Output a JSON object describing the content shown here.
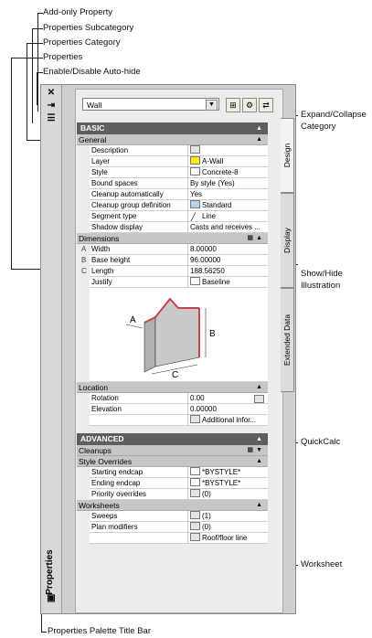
{
  "callouts": {
    "add_only": "Add-only Property",
    "subcategory": "Properties Subcategory",
    "category": "Properties Category",
    "properties": "Properties",
    "auto_hide": "Enable/Disable Auto-hide",
    "expand_collapse_1": "Expand/Collapse",
    "expand_collapse_2": "Category",
    "show_hide_1": "Show/Hide",
    "show_hide_2": "Illustration",
    "quickcalc": "QuickCalc",
    "worksheet": "Worksheet",
    "title_bar": "Properties Palette Title Bar"
  },
  "palette": {
    "title": "Properties",
    "close_glyph": "✕",
    "autohide_glyph": "⇥",
    "props_glyph": "☰",
    "tabs": [
      "Design",
      "Display",
      "Extended Data"
    ],
    "combo_value": "Wall"
  },
  "basic": {
    "header": "BASIC",
    "general": "General",
    "rows": [
      {
        "k": "Description",
        "v": ""
      },
      {
        "k": "Layer",
        "v": "A-Wall"
      },
      {
        "k": "Style",
        "v": "Concrete-8"
      },
      {
        "k": "Bound spaces",
        "v": "By style (Yes)"
      },
      {
        "k": "Cleanup automatically",
        "v": "Yes"
      },
      {
        "k": "Cleanup group definition",
        "v": "Standard"
      },
      {
        "k": "Segment type",
        "v": "Line"
      },
      {
        "k": "Shadow display",
        "v": "Casts and receives ..."
      }
    ],
    "dimensions": "Dimensions",
    "dim_rows": [
      {
        "letter": "A",
        "k": "Width",
        "v": "8.00000"
      },
      {
        "letter": "B",
        "k": "Base height",
        "v": "96.00000"
      },
      {
        "letter": "C",
        "k": "Length",
        "v": "188.56250"
      },
      {
        "letter": "",
        "k": "Justify",
        "v": "Baseline"
      }
    ],
    "illus_labels": {
      "a": "A",
      "b": "B",
      "c": "C"
    },
    "location": "Location",
    "loc_rows": [
      {
        "k": "Rotation",
        "v": "0.00"
      },
      {
        "k": "Elevation",
        "v": "0.00000"
      },
      {
        "k": "",
        "v": "Additional infor..."
      }
    ]
  },
  "advanced": {
    "header": "ADVANCED",
    "cleanups": "Cleanups",
    "style_overrides": "Style Overrides",
    "so_rows": [
      {
        "k": "Starting endcap",
        "v": "*BYSTYLE*"
      },
      {
        "k": "Ending endcap",
        "v": "*BYSTYLE*"
      },
      {
        "k": "Priority overrides",
        "v": "(0)"
      }
    ],
    "worksheets": "Worksheets",
    "ws_rows": [
      {
        "k": "Sweeps",
        "v": "(1)"
      },
      {
        "k": "Plan modifiers",
        "v": "(0)"
      },
      {
        "k": "",
        "v": "Roof/floor line"
      }
    ]
  }
}
